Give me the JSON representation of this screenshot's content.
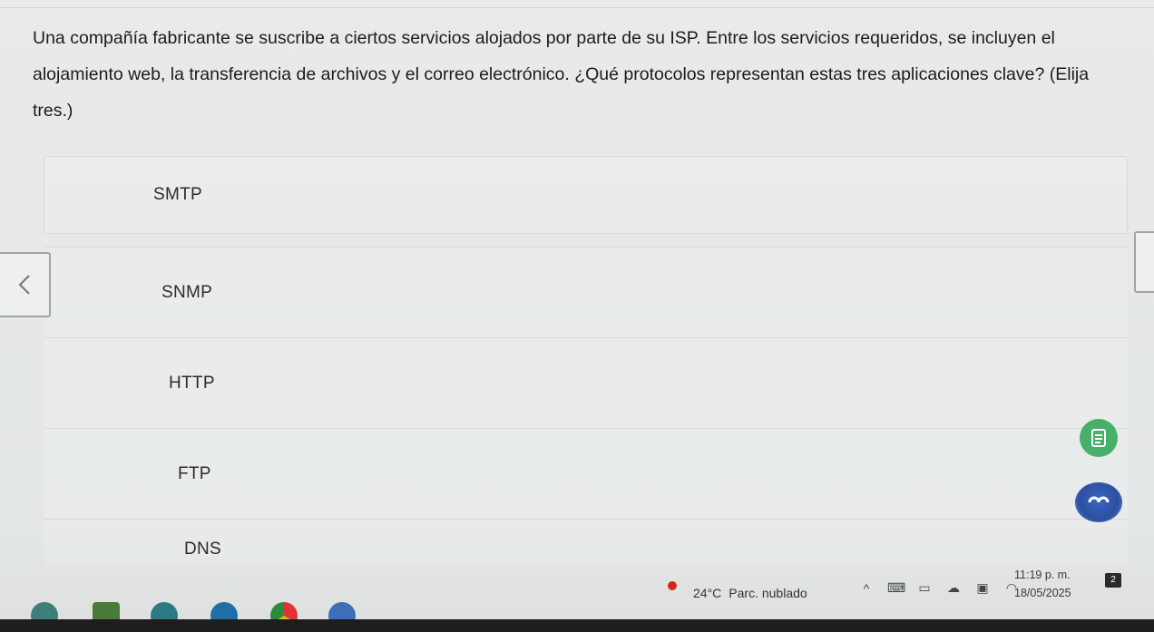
{
  "question": {
    "text": "Una compañía fabricante se suscribe a ciertos servicios alojados por parte de su ISP. Entre los servicios requeridos, se incluyen el alojamiento web, la transferencia de archivos y el correo electrónico. ¿Qué protocolos representan estas tres aplicaciones clave? (Elija tres.)"
  },
  "options": [
    {
      "label": "SMTP"
    },
    {
      "label": "SNMP"
    },
    {
      "label": "HTTP"
    },
    {
      "label": "FTP"
    },
    {
      "label": "DNS"
    }
  ],
  "navigation": {
    "prev_icon": "chevron-left-icon",
    "next_icon": "chevron-right-icon"
  },
  "taskbar": {
    "weather_temp": "24°C",
    "weather_desc": "Parc. nublado",
    "time": "11:19 p. m.",
    "date": "18/05/2025",
    "notification_count": "2"
  },
  "colors": {
    "notes_button": "#46b06a",
    "app_button": "#2d4f9f",
    "weather_alert": "#d7261e"
  }
}
